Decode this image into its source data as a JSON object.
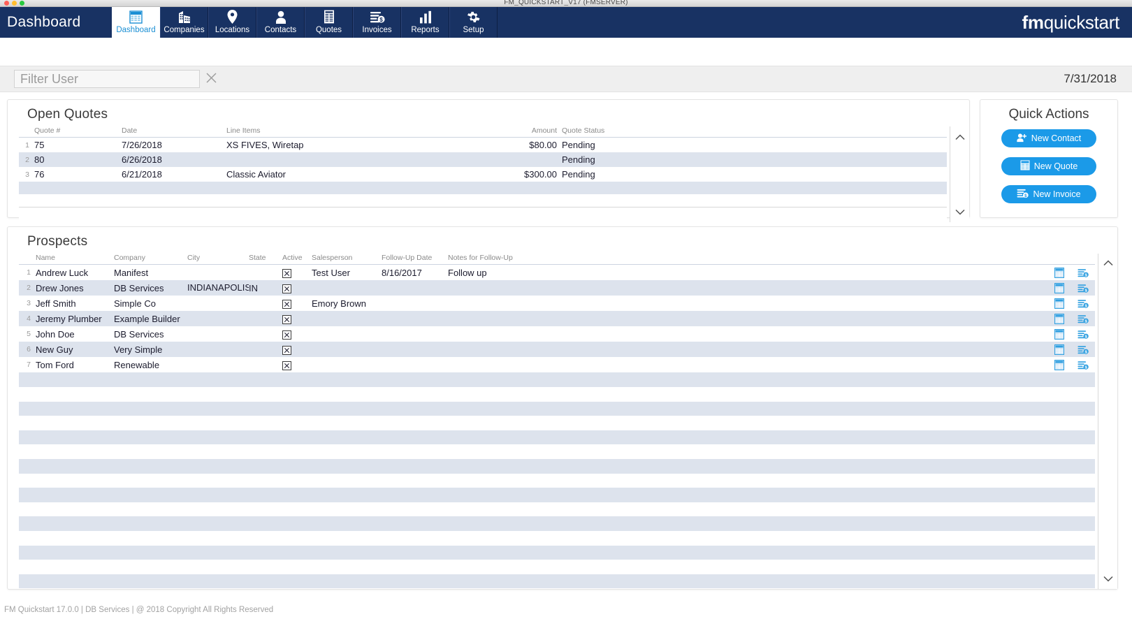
{
  "window": {
    "title": "FM_QUICKSTART_V17 (FMSERVER)"
  },
  "nav": {
    "brand_left": "Dashboard",
    "brand_bold": "fm",
    "brand_light": "quickstart",
    "tabs": [
      {
        "label": "Dashboard",
        "icon": "dashboard-grid-icon",
        "active": true
      },
      {
        "label": "Companies",
        "icon": "building-icon",
        "active": false
      },
      {
        "label": "Locations",
        "icon": "map-pin-icon",
        "active": false
      },
      {
        "label": "Contacts",
        "icon": "person-icon",
        "active": false
      },
      {
        "label": "Quotes",
        "icon": "document-icon",
        "active": false
      },
      {
        "label": "Invoices",
        "icon": "invoice-dollar-icon",
        "active": false
      },
      {
        "label": "Reports",
        "icon": "bar-chart-icon",
        "active": false
      },
      {
        "label": "Setup",
        "icon": "gear-icon",
        "active": false
      }
    ]
  },
  "filter_bar": {
    "placeholder": "Filter User",
    "value": "",
    "clear_icon": "close-x-icon",
    "today_date": "7/31/2018"
  },
  "open_quotes": {
    "title": "Open Quotes",
    "columns": [
      "",
      "Quote #",
      "Date",
      "Line Items",
      "Amount",
      "Quote Status"
    ],
    "rows": [
      {
        "n": "1",
        "quote": "75",
        "date": "7/26/2018",
        "line_items": "XS FIVES, Wiretap",
        "amount": "$80.00",
        "status": "Pending"
      },
      {
        "n": "2",
        "quote": "80",
        "date": "6/26/2018",
        "line_items": "",
        "amount": "",
        "status": "Pending"
      },
      {
        "n": "3",
        "quote": "76",
        "date": "6/21/2018",
        "line_items": "Classic Aviator",
        "amount": "$300.00",
        "status": "Pending"
      }
    ],
    "scroll_up_icon": "chevron-up-icon",
    "scroll_down_icon": "chevron-down-icon"
  },
  "quick_actions": {
    "title": "Quick Actions",
    "buttons": [
      {
        "label": "New Contact",
        "icon": "add-person-icon"
      },
      {
        "label": "New Quote",
        "icon": "quote-doc-icon"
      },
      {
        "label": "New Invoice",
        "icon": "invoice-dollar-icon"
      }
    ]
  },
  "prospects": {
    "title": "Prospects",
    "columns": [
      "",
      "Name",
      "Company",
      "City",
      "State",
      "Active",
      "Salesperson",
      "Follow-Up Date",
      "Notes for Follow-Up"
    ],
    "row_icons": {
      "quote": "create-quote-icon",
      "invoice": "create-invoice-icon"
    },
    "rows": [
      {
        "n": "1",
        "name": "Andrew Luck",
        "company": "Manifest",
        "city": "",
        "state": "",
        "active": true,
        "salesperson": "Test User",
        "follow_up_date": "8/16/2017",
        "notes": "Follow up"
      },
      {
        "n": "2",
        "name": "Drew Jones",
        "company": "DB Services",
        "city": "INDIANAPOLIS",
        "state": "IN",
        "active": true,
        "salesperson": "",
        "follow_up_date": "",
        "notes": ""
      },
      {
        "n": "3",
        "name": "Jeff Smith",
        "company": "Simple Co",
        "city": "",
        "state": "",
        "active": true,
        "salesperson": "Emory Brown",
        "follow_up_date": "",
        "notes": ""
      },
      {
        "n": "4",
        "name": "Jeremy Plumber",
        "company": "Example Builder",
        "city": "",
        "state": "",
        "active": true,
        "salesperson": "",
        "follow_up_date": "",
        "notes": ""
      },
      {
        "n": "5",
        "name": "John Doe",
        "company": "DB Services",
        "city": "",
        "state": "",
        "active": true,
        "salesperson": "",
        "follow_up_date": "",
        "notes": ""
      },
      {
        "n": "6",
        "name": "New Guy",
        "company": "Very Simple",
        "city": "",
        "state": "",
        "active": true,
        "salesperson": "",
        "follow_up_date": "",
        "notes": ""
      },
      {
        "n": "7",
        "name": "Tom Ford",
        "company": "Renewable",
        "city": "",
        "state": "",
        "active": true,
        "salesperson": "",
        "follow_up_date": "",
        "notes": ""
      }
    ],
    "scroll_up_icon": "chevron-up-icon",
    "scroll_down_icon": "chevron-down-icon"
  },
  "footer": {
    "text": "FM Quickstart 17.0.0  | DB Services | @ 2018 Copyright All Rights Reserved"
  },
  "colors": {
    "navy": "#183263",
    "accent_blue": "#1b9ae8",
    "tab_active_text": "#1b8fd4",
    "row_alt": "#dde3ed"
  }
}
